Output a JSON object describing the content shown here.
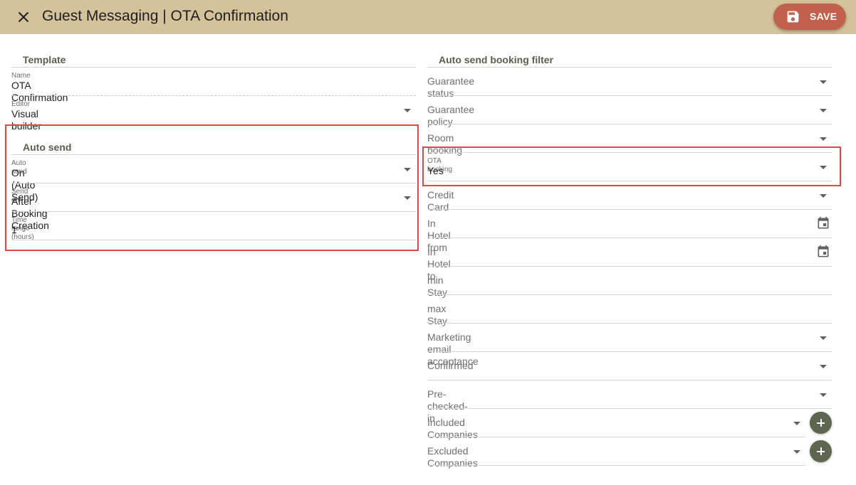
{
  "header": {
    "title": "Guest Messaging | OTA Confirmation",
    "save_label": "SAVE",
    "colors": {
      "bar": "#d3c29a",
      "save_button": "#c2604e"
    }
  },
  "template_section": {
    "title": "Template",
    "name_label": "Name",
    "name_value": "OTA Confirmation",
    "editor_label": "Editor",
    "editor_value": "Visual builder"
  },
  "auto_send_section": {
    "title": "Auto send",
    "auto_send_label": "Auto send",
    "auto_send_value": "On (Auto Send)",
    "send_on_label": "Send on",
    "send_on_value": "After Booking Creation",
    "time_range_label": "Time range (hours)",
    "time_range_value": "1"
  },
  "filter_section": {
    "title": "Auto send booking filter",
    "guarantee_status": "Guarantee status",
    "guarantee_policy": "Guarantee policy",
    "room_booking": "Room booking",
    "ota_booking_label": "OTA booking",
    "ota_booking_value": "Yes",
    "credit_card": "Credit Card",
    "in_hotel_from": "In Hotel from",
    "in_hotel_to": "In Hotel to",
    "min_stay": "min Stay",
    "max_stay": "max Stay",
    "marketing_email": "Marketing email acceptance",
    "confirmed": "Confirmed",
    "pre_checked_in": "Pre-checked-in",
    "included_companies": "Included Companies",
    "excluded_companies": "Excluded Companies"
  },
  "icons": {
    "close": "close-icon",
    "save": "floppy-disk-icon",
    "dropdown": "caret-down-icon",
    "calendar": "calendar-icon",
    "add": "plus-icon"
  },
  "highlight_color": "#e44545"
}
